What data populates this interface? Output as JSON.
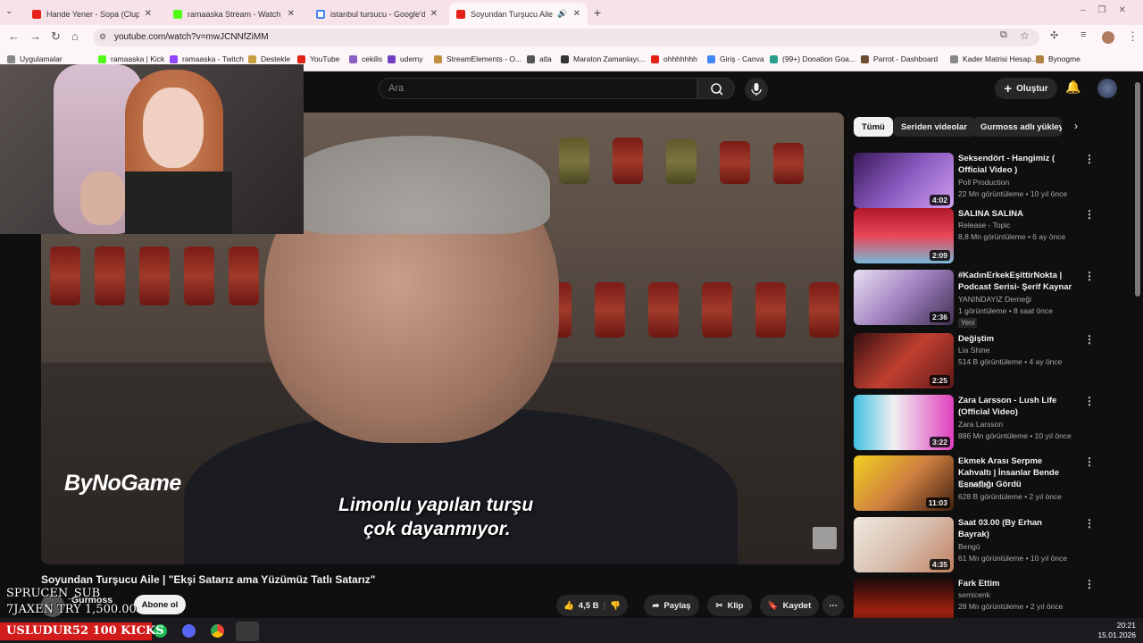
{
  "browser": {
    "tabs": [
      {
        "title": "Hande Yener - Sopa (Clup Rem",
        "color": "#e62117"
      },
      {
        "title": "ramaaska Stream - Watch Live",
        "color": "#53fc18"
      },
      {
        "title": "istanbul tursucu - Google'da A",
        "color": "#4285f4"
      },
      {
        "title": "Soyundan Turşucu Aile | \"Ek",
        "color": "#e62117"
      }
    ],
    "new_tab_symbol": "+",
    "url": "youtube.com/watch?v=mwJCNNfZiMM",
    "bookmarks": [
      "Uygulamalar",
      "ramaaska | Kick",
      "ramaaska - Twitch",
      "Destekle",
      "YouTube",
      "cekilis",
      "udemy",
      "StreamElements - O...",
      "atla",
      "Maraton Zamanlayı...",
      "ohhhhhhh",
      "Giriş - Canva",
      "(99+) Donation Goa...",
      "Parrot - Dashboard",
      "Kader Matrisi Hesap...",
      "Bynogme"
    ]
  },
  "youtube": {
    "search_placeholder": "Ara",
    "create_label": "Oluştur",
    "video": {
      "brand_logo": "ByNoGame",
      "subtitle_line1": "Limonlu yapılan turşu",
      "subtitle_line2": "çok dayanmıyor.",
      "title": "Soyundan Turşucu Aile | \"Ekşi Satarız ama Yüzümüz Tatlı Satarız\"",
      "channel": "Gurmoss",
      "subscribe_label": "Abone ol",
      "likes": "4,5 B",
      "share_label": "Paylaş",
      "clip_label": "Klip",
      "save_label": "Kaydet"
    },
    "chips": [
      "Tümü",
      "Seriden videolar",
      "Gurmoss adlı yükleyic"
    ],
    "related": [
      {
        "title": "Seksendört - Hangimiz ( Official Video )",
        "channel": "Poll Production",
        "meta": "22 Mn görüntüleme • 10 yıl önce",
        "duration": "4:02",
        "bg": "linear-gradient(135deg,#3a1a5a,#8a5ac0 50%,#d0a0f0)"
      },
      {
        "title": "SALINA SALINA",
        "channel": "Release - Topic",
        "meta": "8,8 Mn görüntüleme • 6 ay önce",
        "duration": "2:09",
        "bg": "linear-gradient(180deg,#b01828,#e84858 50%,#7ab8d8)"
      },
      {
        "title": "#KadınErkekEşittirNokta | Podcast Serisi- Şerif Kaynar",
        "channel": "YANINDAYIZ Derneği",
        "meta": "1 görüntüleme • 8 saat önce",
        "duration": "2:36",
        "badge": "Yeni",
        "bg": "linear-gradient(135deg,#e8e0f0,#a080c0 50%,#403050)"
      },
      {
        "title": "Değiştim",
        "channel": "Lia Shine",
        "meta": "514 B görüntüleme • 4 ay önce",
        "duration": "2:25",
        "bg": "linear-gradient(135deg,#3a1010,#c04030 50%,#601818)"
      },
      {
        "title": "Zara Larsson - Lush Life (Official Video)",
        "channel": "Zara Larsson",
        "meta": "886 Mn görüntüleme • 10 yıl önce",
        "duration": "3:22",
        "bg": "linear-gradient(90deg,#40c0e0,#f0f0f0 40%,#e040c0)"
      },
      {
        "title": "Ekmek Arası Serpme Kahvaltı | İnsanlar Bende Esnaflığı Gördü",
        "channel": "Gurmoss",
        "meta": "628 B görüntüleme • 2 yıl önce",
        "duration": "11:03",
        "bg": "linear-gradient(135deg,#f0d020,#d08040 50%,#402010)"
      },
      {
        "title": "Saat 03.00 (By Erhan Bayrak)",
        "channel": "Bengü",
        "meta": "61 Mn görüntüleme • 10 yıl önce",
        "duration": "4:35",
        "bg": "linear-gradient(135deg,#f0e8e0,#d8c0b0 50%,#c08060)"
      },
      {
        "title": "Fark Ettim",
        "channel": "semicenk",
        "meta": "28 Mn görüntüleme • 2 yıl önce",
        "duration": "",
        "bg": "linear-gradient(180deg,#1a0808,#a02010 60%,#300808)"
      }
    ]
  },
  "overlay": {
    "line1": "SPRUCEN_SUB",
    "line2": "7JAXEN TRY 1,500.00",
    "goal_text": "USLUDUR52 100 KICKS"
  },
  "taskbar": {
    "time": "20:21",
    "date": "15.01.2026"
  }
}
